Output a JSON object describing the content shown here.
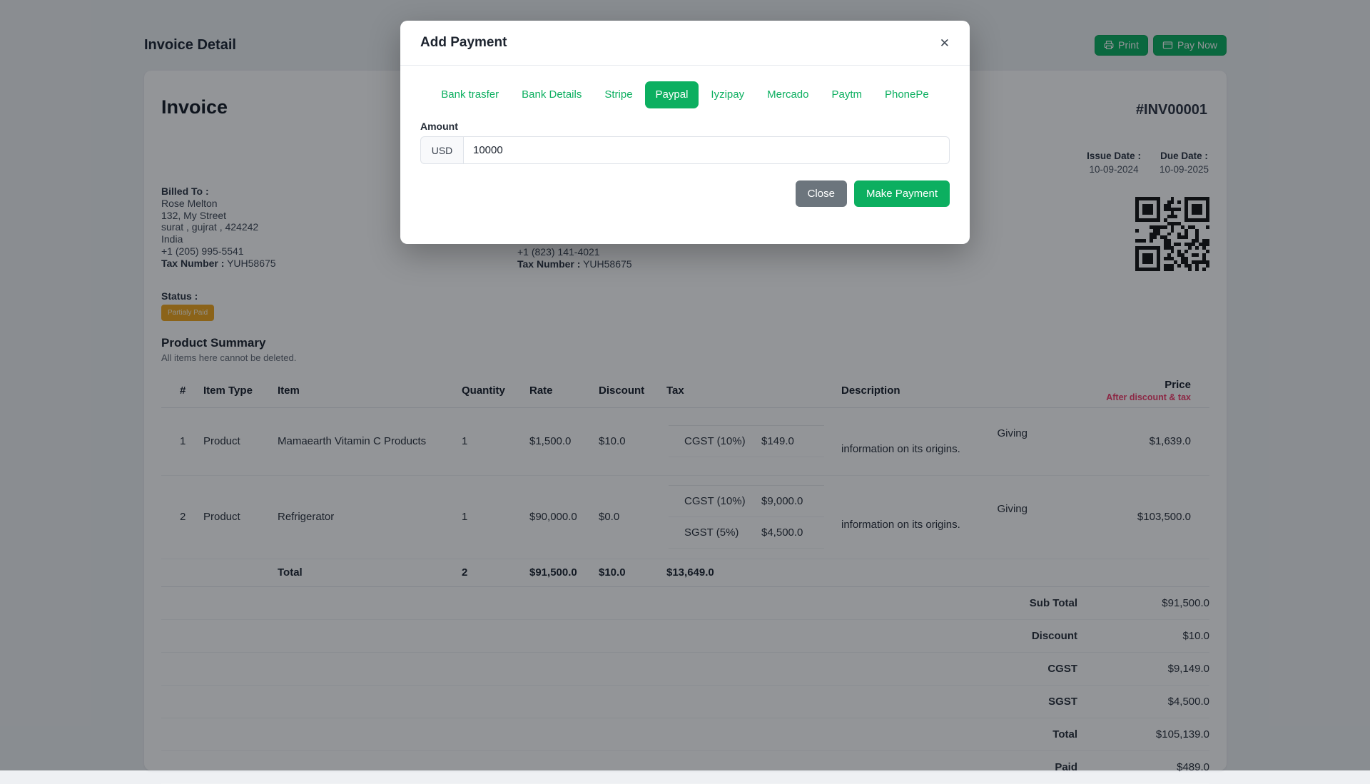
{
  "page": {
    "title": "Invoice Detail",
    "print_label": "Print",
    "pay_now_label": "Pay Now"
  },
  "invoice": {
    "heading": "Invoice",
    "number": "#INV00001",
    "billed_to": {
      "label": "Billed To :",
      "name": "Rose Melton",
      "address_line1": "132, My Street",
      "address_line2": "surat , gujrat , 424242",
      "country": "India",
      "phone": "+1 (205) 995-5541",
      "tax_label": "Tax Number :",
      "tax_value": "YUH58675"
    },
    "shipped_to_visible": {
      "phone": "+1 (823) 141-4021",
      "tax_label": "Tax Number :",
      "tax_value": "YUH58675"
    },
    "issue_date_label": "Issue Date :",
    "issue_date": "10-09-2024",
    "due_date_label": "Due Date :",
    "due_date": "10-09-2025",
    "status_label": "Status :",
    "status_value": "Partialy Paid"
  },
  "product_summary": {
    "title": "Product Summary",
    "note": "All items here cannot be deleted.",
    "columns": [
      "#",
      "Item Type",
      "Item",
      "Quantity",
      "Rate",
      "Discount",
      "Tax",
      "Description",
      "Price"
    ],
    "price_subnote": "After discount & tax",
    "rows": [
      {
        "index": "1",
        "item_type": "Product",
        "item": "Mamaearth Vitamin C Products",
        "quantity": "1",
        "rate": "$1,500.0",
        "discount": "$10.0",
        "taxes": [
          {
            "name": "CGST (10%)",
            "amount": "$149.0"
          }
        ],
        "description": "Giving information on its origins.",
        "description_line1": "Giving",
        "description_line2": "information on its origins.",
        "price": "$1,639.0"
      },
      {
        "index": "2",
        "item_type": "Product",
        "item": "Refrigerator",
        "quantity": "1",
        "rate": "$90,000.0",
        "discount": "$0.0",
        "taxes": [
          {
            "name": "CGST (10%)",
            "amount": "$9,000.0"
          },
          {
            "name": "SGST (5%)",
            "amount": "$4,500.0"
          }
        ],
        "description": "Giving information on its origins.",
        "description_line1": "Giving",
        "description_line2": "information on its origins.",
        "price": "$103,500.0"
      }
    ],
    "totals_row": {
      "label": "Total",
      "quantity": "2",
      "rate": "$91,500.0",
      "discount": "$10.0",
      "tax": "$13,649.0"
    },
    "summary_rows": [
      {
        "label": "Sub Total",
        "value": "$91,500.0"
      },
      {
        "label": "Discount",
        "value": "$10.0"
      },
      {
        "label": "CGST",
        "value": "$9,149.0"
      },
      {
        "label": "SGST",
        "value": "$4,500.0"
      },
      {
        "label": "Total",
        "value": "$105,139.0"
      },
      {
        "label": "Paid",
        "value": "$489.0"
      }
    ]
  },
  "modal": {
    "title": "Add Payment",
    "close_icon": "✕",
    "tabs": [
      {
        "label": "Bank trasfer",
        "active": false
      },
      {
        "label": "Bank Details",
        "active": false
      },
      {
        "label": "Stripe",
        "active": false
      },
      {
        "label": "Paypal",
        "active": true
      },
      {
        "label": "Iyzipay",
        "active": false
      },
      {
        "label": "Mercado",
        "active": false
      },
      {
        "label": "Paytm",
        "active": false
      },
      {
        "label": "PhonePe",
        "active": false
      }
    ],
    "amount_label": "Amount",
    "currency": "USD",
    "amount_value": "10000",
    "close_button": "Close",
    "submit_button": "Make Payment"
  },
  "colors": {
    "accent_green": "#0caf60",
    "warning_badge": "#f0a71d",
    "danger_red": "#f23d6b",
    "secondary_grey": "#6c757d"
  }
}
